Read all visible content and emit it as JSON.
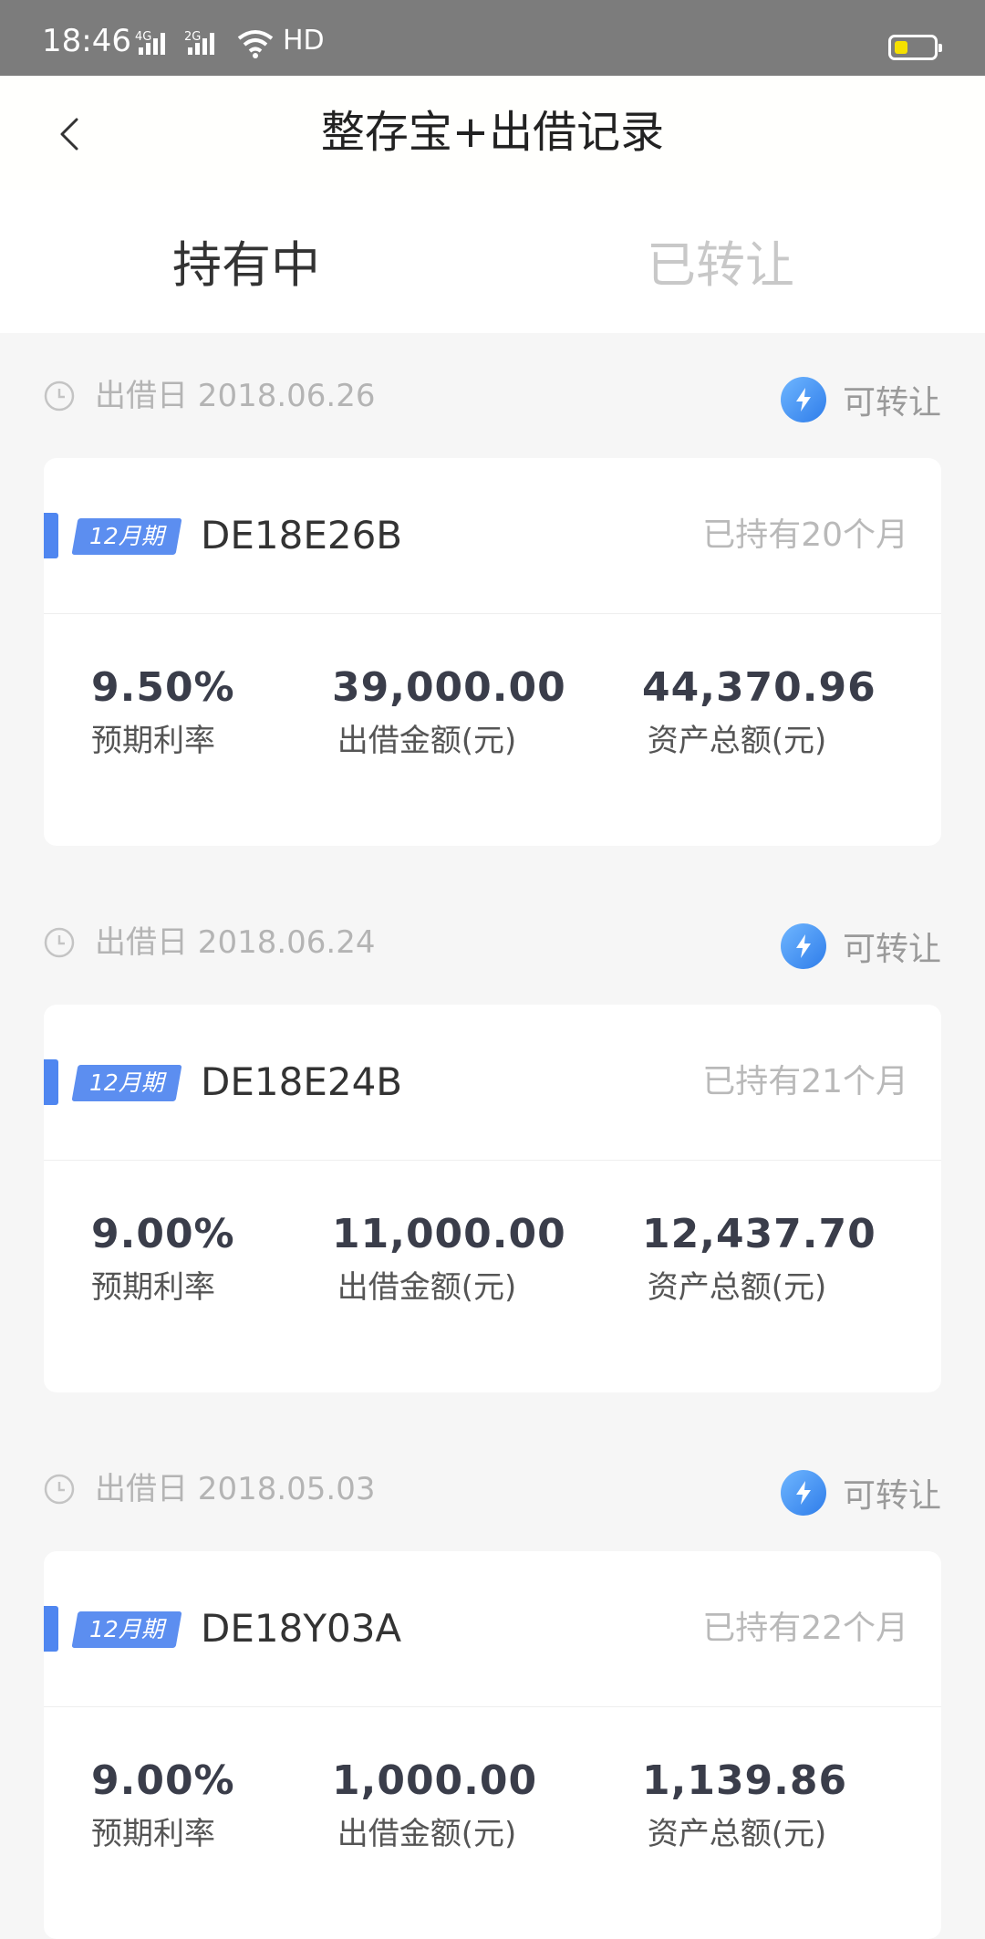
{
  "status_bar": {
    "time": "18:46",
    "network": "HD",
    "signal_1": "4G",
    "signal_2": "2G"
  },
  "header": {
    "title": "整存宝+出借记录",
    "back_icon": "chevron-left-icon"
  },
  "tabs": [
    {
      "label": "持有中",
      "active": true
    },
    {
      "label": "已转让",
      "active": false
    }
  ],
  "records": [
    {
      "date_label": "出借日 2018.06.26",
      "transfer_label": "可转让",
      "term": "12月期",
      "code": "DE18E26B",
      "held": "已持有20个月",
      "rate": "9.50%",
      "rate_label": "预期利率",
      "amount": "39,000.00",
      "amount_label": "出借金额(元)",
      "total": "44,370.96",
      "total_label": "资产总额(元)"
    },
    {
      "date_label": "出借日 2018.06.24",
      "transfer_label": "可转让",
      "term": "12月期",
      "code": "DE18E24B",
      "held": "已持有21个月",
      "rate": "9.00%",
      "rate_label": "预期利率",
      "amount": "11,000.00",
      "amount_label": "出借金额(元)",
      "total": "12,437.70",
      "total_label": "资产总额(元)"
    },
    {
      "date_label": "出借日 2018.05.03",
      "transfer_label": "可转让",
      "term": "12月期",
      "code": "DE18Y03A",
      "held": "已持有22个月",
      "rate": "9.00%",
      "rate_label": "预期利率",
      "amount": "1,000.00",
      "amount_label": "出借金额(元)",
      "total": "1,139.86",
      "total_label": "资产总额(元)"
    }
  ],
  "colors": {
    "accent": "#4f86f0",
    "status_bar": "#7c7c7c",
    "battery": "#f5e000"
  }
}
